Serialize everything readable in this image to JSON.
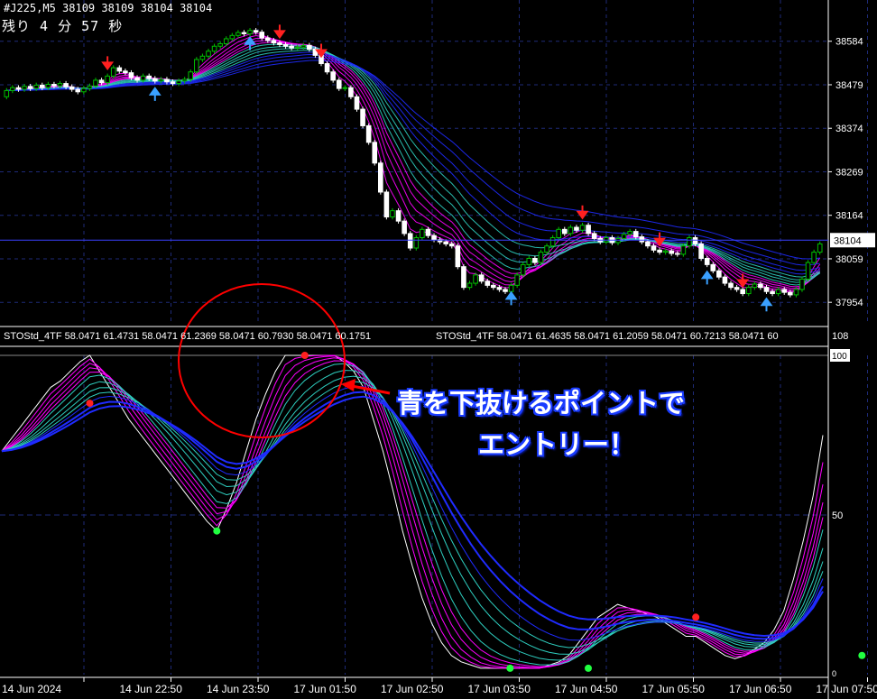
{
  "header": {
    "symbol": "#J225,M5",
    "ohlc": "38109 38109 38104 38104",
    "countdown": "残り 4 分 57 秒"
  },
  "indicator": {
    "label_1": "STOStd_4TF 58.0471 61.4731 58.0471 61.2369 58.0471 60.7930 58.0471 60.1751",
    "label_2": "STOStd_4TF 58.0471 61.4635 58.0471 61.2059 58.0471 60.7213 58.0471 60"
  },
  "annotation": {
    "line_1": "青を下抜けるポイントで",
    "line_2": "エントリー！"
  },
  "colors": {
    "background": "#000000",
    "grid": "#1e2a78",
    "axis": "#ffffff",
    "bull_candle": "#00c000",
    "bear_candle": "#ffffff",
    "ribbon_magenta": "#ff00ff",
    "ribbon_cyan": "#2ecfc0",
    "ribbon_blue": "#1f2bff",
    "signal_red": "#ff2020",
    "signal_green": "#20ff40",
    "circle": "#ff0000",
    "arrow_head": "#ff2020",
    "price_line": "#3a40ff",
    "callout_text": "#ffffff",
    "callout_outline": "#1a3cff"
  },
  "chart_data": [
    {
      "type": "candlestick",
      "title": "#J225,M5",
      "ylim": [
        37900,
        38640
      ],
      "yticks": [
        38584,
        38479,
        38374,
        38269,
        38164,
        38059,
        37954
      ],
      "current_price": 38104,
      "candles": [
        {
          "o": 38450,
          "c": 38465
        },
        {
          "o": 38465,
          "c": 38472
        },
        {
          "o": 38472,
          "c": 38468
        },
        {
          "o": 38468,
          "c": 38475
        },
        {
          "o": 38475,
          "c": 38470
        },
        {
          "o": 38470,
          "c": 38478
        },
        {
          "o": 38478,
          "c": 38472
        },
        {
          "o": 38472,
          "c": 38480
        },
        {
          "o": 38480,
          "c": 38476
        },
        {
          "o": 38476,
          "c": 38482
        },
        {
          "o": 38482,
          "c": 38474
        },
        {
          "o": 38474,
          "c": 38468
        },
        {
          "o": 38468,
          "c": 38462
        },
        {
          "o": 38462,
          "c": 38470
        },
        {
          "o": 38470,
          "c": 38476
        },
        {
          "o": 38476,
          "c": 38490
        },
        {
          "o": 38490,
          "c": 38484
        },
        {
          "o": 38484,
          "c": 38500
        },
        {
          "o": 38500,
          "c": 38520
        },
        {
          "o": 38520,
          "c": 38512
        },
        {
          "o": 38512,
          "c": 38508
        },
        {
          "o": 38508,
          "c": 38496
        },
        {
          "o": 38496,
          "c": 38490
        },
        {
          "o": 38490,
          "c": 38500
        },
        {
          "o": 38500,
          "c": 38494
        },
        {
          "o": 38494,
          "c": 38488
        },
        {
          "o": 38488,
          "c": 38492
        },
        {
          "o": 38492,
          "c": 38486
        },
        {
          "o": 38486,
          "c": 38482
        },
        {
          "o": 38482,
          "c": 38488
        },
        {
          "o": 38488,
          "c": 38492
        },
        {
          "o": 38492,
          "c": 38510
        },
        {
          "o": 38510,
          "c": 38540
        },
        {
          "o": 38540,
          "c": 38548
        },
        {
          "o": 38548,
          "c": 38560
        },
        {
          "o": 38560,
          "c": 38572
        },
        {
          "o": 38572,
          "c": 38578
        },
        {
          "o": 38578,
          "c": 38590
        },
        {
          "o": 38590,
          "c": 38598
        },
        {
          "o": 38598,
          "c": 38605
        },
        {
          "o": 38605,
          "c": 38602
        },
        {
          "o": 38602,
          "c": 38610
        },
        {
          "o": 38610,
          "c": 38606
        },
        {
          "o": 38606,
          "c": 38592
        },
        {
          "o": 38592,
          "c": 38586
        },
        {
          "o": 38586,
          "c": 38580
        },
        {
          "o": 38580,
          "c": 38576
        },
        {
          "o": 38576,
          "c": 38572
        },
        {
          "o": 38572,
          "c": 38568
        },
        {
          "o": 38568,
          "c": 38570
        },
        {
          "o": 38570,
          "c": 38574
        },
        {
          "o": 38574,
          "c": 38565
        },
        {
          "o": 38565,
          "c": 38550
        },
        {
          "o": 38550,
          "c": 38530
        },
        {
          "o": 38530,
          "c": 38510
        },
        {
          "o": 38510,
          "c": 38490
        },
        {
          "o": 38490,
          "c": 38470
        },
        {
          "o": 38470,
          "c": 38472
        },
        {
          "o": 38472,
          "c": 38450
        },
        {
          "o": 38450,
          "c": 38420
        },
        {
          "o": 38420,
          "c": 38380
        },
        {
          "o": 38380,
          "c": 38340
        },
        {
          "o": 38340,
          "c": 38290
        },
        {
          "o": 38290,
          "c": 38220
        },
        {
          "o": 38220,
          "c": 38160
        },
        {
          "o": 38160,
          "c": 38175
        },
        {
          "o": 38175,
          "c": 38150
        },
        {
          "o": 38150,
          "c": 38120
        },
        {
          "o": 38120,
          "c": 38085
        },
        {
          "o": 38085,
          "c": 38110
        },
        {
          "o": 38110,
          "c": 38130
        },
        {
          "o": 38130,
          "c": 38115
        },
        {
          "o": 38115,
          "c": 38105
        },
        {
          "o": 38105,
          "c": 38100
        },
        {
          "o": 38100,
          "c": 38095
        },
        {
          "o": 38095,
          "c": 38090
        },
        {
          "o": 38090,
          "c": 38040
        },
        {
          "o": 38040,
          "c": 37990
        },
        {
          "o": 37990,
          "c": 38000
        },
        {
          "o": 38000,
          "c": 38020
        },
        {
          "o": 38020,
          "c": 38005
        },
        {
          "o": 38005,
          "c": 37995
        },
        {
          "o": 37995,
          "c": 37990
        },
        {
          "o": 37990,
          "c": 37985
        },
        {
          "o": 37985,
          "c": 37980
        },
        {
          "o": 37980,
          "c": 37995
        },
        {
          "o": 37995,
          "c": 38020
        },
        {
          "o": 38020,
          "c": 38045
        },
        {
          "o": 38045,
          "c": 38060
        },
        {
          "o": 38060,
          "c": 38050
        },
        {
          "o": 38050,
          "c": 38075
        },
        {
          "o": 38075,
          "c": 38090
        },
        {
          "o": 38090,
          "c": 38110
        },
        {
          "o": 38110,
          "c": 38130
        },
        {
          "o": 38130,
          "c": 38120
        },
        {
          "o": 38120,
          "c": 38135
        },
        {
          "o": 38135,
          "c": 38128
        },
        {
          "o": 38128,
          "c": 38140
        },
        {
          "o": 38140,
          "c": 38120
        },
        {
          "o": 38120,
          "c": 38108
        },
        {
          "o": 38108,
          "c": 38100
        },
        {
          "o": 38100,
          "c": 38110
        },
        {
          "o": 38110,
          "c": 38098
        },
        {
          "o": 38098,
          "c": 38108
        },
        {
          "o": 38108,
          "c": 38118
        },
        {
          "o": 38118,
          "c": 38125
        },
        {
          "o": 38125,
          "c": 38112
        },
        {
          "o": 38112,
          "c": 38100
        },
        {
          "o": 38100,
          "c": 38090
        },
        {
          "o": 38090,
          "c": 38080
        },
        {
          "o": 38080,
          "c": 38075
        },
        {
          "o": 38075,
          "c": 38078
        },
        {
          "o": 38078,
          "c": 38072
        },
        {
          "o": 38072,
          "c": 38070
        },
        {
          "o": 38070,
          "c": 38090
        },
        {
          "o": 38090,
          "c": 38110
        },
        {
          "o": 38110,
          "c": 38095
        },
        {
          "o": 38095,
          "c": 38060
        },
        {
          "o": 38060,
          "c": 38045
        },
        {
          "o": 38045,
          "c": 38030
        },
        {
          "o": 38030,
          "c": 38015
        },
        {
          "o": 38015,
          "c": 38000
        },
        {
          "o": 38000,
          "c": 37990
        },
        {
          "o": 37990,
          "c": 37985
        },
        {
          "o": 37985,
          "c": 37975
        },
        {
          "o": 37975,
          "c": 37990
        },
        {
          "o": 37990,
          "c": 37998
        },
        {
          "o": 37998,
          "c": 37990
        },
        {
          "o": 37990,
          "c": 37980
        },
        {
          "o": 37980,
          "c": 37975
        },
        {
          "o": 37975,
          "c": 37985
        },
        {
          "o": 37985,
          "c": 37978
        },
        {
          "o": 37978,
          "c": 37972
        },
        {
          "o": 37972,
          "c": 37985
        },
        {
          "o": 37985,
          "c": 38010
        },
        {
          "o": 38010,
          "c": 38050
        },
        {
          "o": 38050,
          "c": 38075
        },
        {
          "o": 38075,
          "c": 38095
        }
      ]
    },
    {
      "type": "line",
      "title": "STOStd_4TF",
      "ylim": [
        0,
        100
      ],
      "yticks": [
        100,
        50,
        0
      ],
      "y2_label_top": "108",
      "series": [
        {
          "values": [
            70,
            74,
            78,
            82,
            86,
            90,
            92,
            95,
            98,
            100,
            95,
            90,
            85,
            80,
            76,
            72,
            68,
            64,
            60,
            56,
            52,
            48,
            45,
            52,
            60,
            70,
            80,
            88,
            95,
            100,
            100,
            100,
            100,
            100,
            100,
            98,
            95,
            90,
            80,
            70,
            58,
            45,
            34,
            24,
            16,
            10,
            6,
            4,
            3,
            2,
            2,
            2,
            2,
            2,
            2,
            2,
            3,
            4,
            6,
            10,
            14,
            18,
            20,
            22,
            21,
            20,
            19,
            18,
            16,
            14,
            12,
            12,
            10,
            8,
            6,
            5,
            6,
            8,
            10,
            14,
            20,
            30,
            42,
            56,
            75
          ]
        }
      ],
      "signal_points": [
        {
          "color": "red",
          "x_index": 9,
          "y": 85
        },
        {
          "color": "green",
          "x_index": 22,
          "y": 45
        },
        {
          "color": "red",
          "x_index": 31,
          "y": 100
        },
        {
          "color": "green",
          "x_index": 52,
          "y": 2
        },
        {
          "color": "green",
          "x_index": 60,
          "y": 2
        },
        {
          "color": "red",
          "x_index": 71,
          "y": 18
        },
        {
          "color": "green",
          "x_index": 88,
          "y": 6
        },
        {
          "color": "red",
          "x_index": 90,
          "y": 7
        },
        {
          "color": "green",
          "x_index": 91,
          "y": 6
        }
      ]
    }
  ],
  "x_axis_labels": [
    "14 Jun 2024",
    "14 Jun 22:50",
    "14 Jun 23:50",
    "17 Jun 01:50",
    "17 Jun 02:50",
    "17 Jun 03:50",
    "17 Jun 04:50",
    "17 Jun 05:50",
    "17 Jun 06:50",
    "17 Jun 07:50"
  ]
}
